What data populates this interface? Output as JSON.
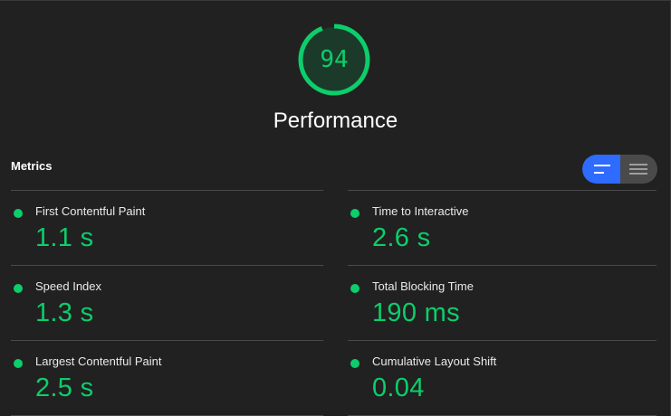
{
  "score": {
    "value": "94",
    "fraction": 0.94,
    "title": "Performance",
    "color": "#0cce6b",
    "track_color": "#1b3a29"
  },
  "metrics": {
    "header": "Metrics",
    "view_toggle": {
      "options": [
        "compact-view-icon",
        "expanded-view-icon"
      ],
      "selected": "compact-view-icon",
      "accent": "#2e6bff"
    },
    "items": [
      {
        "label": "First Contentful Paint",
        "value": "1.1 s",
        "status": "pass",
        "color": "#0cce6b"
      },
      {
        "label": "Time to Interactive",
        "value": "2.6 s",
        "status": "pass",
        "color": "#0cce6b"
      },
      {
        "label": "Speed Index",
        "value": "1.3 s",
        "status": "pass",
        "color": "#0cce6b"
      },
      {
        "label": "Total Blocking Time",
        "value": "190 ms",
        "status": "pass",
        "color": "#0cce6b"
      },
      {
        "label": "Largest Contentful Paint",
        "value": "2.5 s",
        "status": "pass",
        "color": "#0cce6b"
      },
      {
        "label": "Cumulative Layout Shift",
        "value": "0.04",
        "status": "pass",
        "color": "#0cce6b"
      }
    ]
  }
}
